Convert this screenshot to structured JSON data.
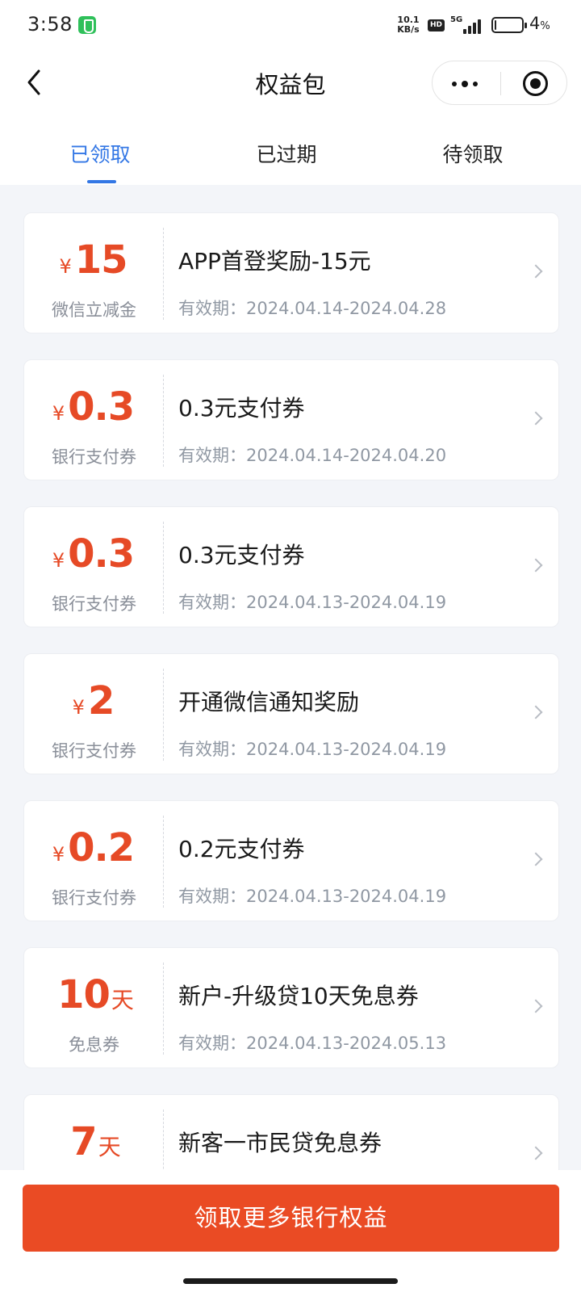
{
  "status_bar": {
    "time": "3:58",
    "net_speed_value": "10.1",
    "net_speed_unit": "KB/s",
    "hd": "HD",
    "network": "5G",
    "battery_pct": "4",
    "battery_unit": "%",
    "battery_level": 0.04
  },
  "nav": {
    "title": "权益包",
    "back_icon": "chevron-left-icon",
    "more_icon": "more-dots-icon",
    "close_icon": "target-close-icon"
  },
  "tabs": [
    {
      "label": "已领取",
      "active": true
    },
    {
      "label": "已过期",
      "active": false
    },
    {
      "label": "待领取",
      "active": false
    }
  ],
  "colors": {
    "accent_blue": "#3377e5",
    "coupon_red": "#e64a26",
    "cta_red": "#ea4b24",
    "page_bg": "#f3f5f9"
  },
  "coupons": [
    {
      "currency": "¥",
      "amount": "15",
      "unit": "",
      "kind": "微信立减金",
      "name": "APP首登奖励-15元",
      "validity": "有效期：2024.04.14-2024.04.28"
    },
    {
      "currency": "¥",
      "amount": "0.3",
      "unit": "",
      "kind": "银行支付券",
      "name": "0.3元支付券",
      "validity": "有效期：2024.04.14-2024.04.20"
    },
    {
      "currency": "¥",
      "amount": "0.3",
      "unit": "",
      "kind": "银行支付券",
      "name": "0.3元支付券",
      "validity": "有效期：2024.04.13-2024.04.19"
    },
    {
      "currency": "¥",
      "amount": "2",
      "unit": "",
      "kind": "银行支付券",
      "name": "开通微信通知奖励",
      "validity": "有效期：2024.04.13-2024.04.19"
    },
    {
      "currency": "¥",
      "amount": "0.2",
      "unit": "",
      "kind": "银行支付券",
      "name": "0.2元支付券",
      "validity": "有效期：2024.04.13-2024.04.19"
    },
    {
      "currency": "",
      "amount": "10",
      "unit": "天",
      "kind": "免息券",
      "name": "新户-升级贷10天免息券",
      "validity": "有效期：2024.04.13-2024.05.13"
    },
    {
      "currency": "",
      "amount": "7",
      "unit": "天",
      "kind": "",
      "name": "新客一市民贷免息券",
      "validity": ""
    }
  ],
  "cta": {
    "label": "领取更多银行权益"
  }
}
